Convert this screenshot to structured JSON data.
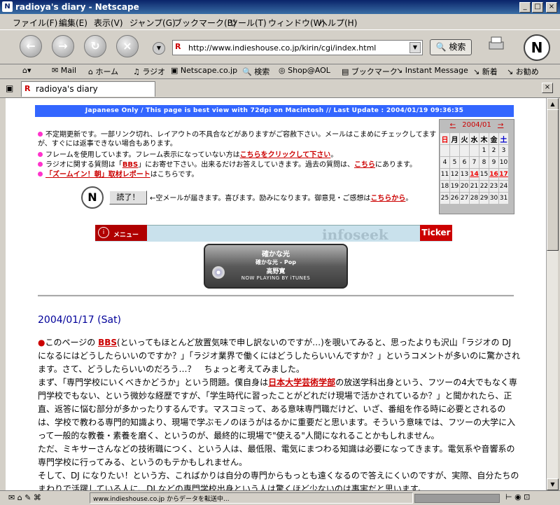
{
  "window": {
    "title": "radioya's diary - Netscape"
  },
  "menu": [
    "ファイル(F)",
    "編集(E)",
    "表示(V)",
    "ジャンプ(G)",
    "ブックマーク(B)",
    "ツール(T)",
    "ウィンドウ(W)",
    "ヘルプ(H)"
  ],
  "nav": {
    "url": "http://www.indieshouse.co.jp/kirin/cgi/index.html",
    "search_label": "検索"
  },
  "personal_toolbar": [
    "Mail",
    "ホーム",
    "ラジオ",
    "Netscape.co.jp",
    "検索",
    "Shop@AOL",
    "ブックマーク",
    "Instant Message",
    "新着",
    "お勧め"
  ],
  "tab": {
    "label": "radioya's diary"
  },
  "page": {
    "banner": "Japanese Only / This page is best view with 72dpi on Macintosh // Last Update : 2004/01/19 09:36:35",
    "notices": [
      {
        "text": "不定期更新です。一部リンク切れ、レイアウトの不具合などがありますがご容赦下さい。メールはこまめにチェックしてますが、すぐには返事できない場合もあります。"
      },
      {
        "pre": "フレームを使用しています。フレーム表示になっていない方は",
        "link": "こちらをクリックして下さい",
        "post": "。"
      },
      {
        "pre": "ラジオに関する質問は「",
        "link": "BBS",
        "mid": "」にお寄せ下さい。出来るだけお答えしていきます。過去の質問は、",
        "link2": "こちら",
        "post": "にあります。"
      },
      {
        "link": "「ズームイン！朝」取材レポート",
        "post": "はこちらです。"
      }
    ],
    "read_button": "読了！",
    "read_text_pre": "←空メールが届きます。喜びます。励みになります。御意見・ご感想は",
    "read_link": "こちらから",
    "read_text_post": "。",
    "ticker": {
      "menu_label": "メニュー",
      "watermark": "infoseek",
      "label": "Ticker"
    },
    "itunes": {
      "song": "確かな光",
      "line2": "確かな光 - Pop",
      "artist": "高野寛",
      "caption": "NOW PLAYING BY iTUNES"
    },
    "calendar": {
      "month": "2004/01",
      "prev": "←",
      "next": "→",
      "weekdays": [
        "日",
        "月",
        "火",
        "水",
        "木",
        "金",
        "土"
      ],
      "weeks": [
        [
          "",
          "",
          "",
          "",
          "1",
          "2",
          "3"
        ],
        [
          "4",
          "5",
          "6",
          "7",
          "8",
          "9",
          "10"
        ],
        [
          "11",
          "12",
          "13",
          "14",
          "15",
          "16",
          "17"
        ],
        [
          "18",
          "19",
          "20",
          "21",
          "22",
          "23",
          "24"
        ],
        [
          "25",
          "26",
          "27",
          "28",
          "29",
          "30",
          "31"
        ]
      ],
      "highlighted": [
        "14",
        "16",
        "17"
      ]
    },
    "date_heading": "2004/01/17 (Sat)",
    "article": {
      "p1_pre": "このページの ",
      "p1_link": "BBS",
      "p1_post": "(といってもほとんど放置気味で申し訳ないのですが…)を覗いてみると、思ったよりも沢山「ラジオの DJ になるにはどうしたらいいのですか？」「ラジオ業界で働くにはどうしたらいいんですか？」というコメントが多いのに驚かされます。さて、どうしたらいいのだろう…？　ちょっと考えてみました。",
      "p2_pre": "まず、「専門学校にいくべきかどうか」という問題。僕自身は",
      "p2_link": "日本大学芸術学部",
      "p2_post": "の放送学科出身という、フツーの4大でもなく専門学校でもない、という微妙な経歴ですが、「学生時代に習ったことがどれだけ現場で活かされているか？」と聞かれたら、正直、返答に悩む部分が多かったりするんです。マスコミって、ある意味専門職だけど、いざ、番組を作る時に必要とされるのは、学校で教わる専門的知識より、現場で学ぶモノのほうがはるかに重要だと思います。そういう意味では、フツーの大学に入って一般的な教養・素養を磨く、というのが、最終的に現場で\"使える\"人間になれることかもしれません。",
      "p3": "ただ、ミキサーさんなどの技術職につく、という人は、最低限、電気にまつわる知識は必要になってきます。電気系や音響系の専門学校に行ってみる、というのもテかもしれません。",
      "p4": "そして、DJ になりたい！という方、こればかりは自分の専門からもっとも遠くなるので答えにくいのですが、実際、自分たちのまわりで活躍している人に、DJ などの専門学校出身という人は驚くほど少ないのは事実だと思います。"
    }
  },
  "status": {
    "text": "www.indieshouse.co.jp からデータを転送中..."
  },
  "colors": {
    "accent": "#3366ff",
    "link": "#cc0000",
    "date": "#000099"
  }
}
